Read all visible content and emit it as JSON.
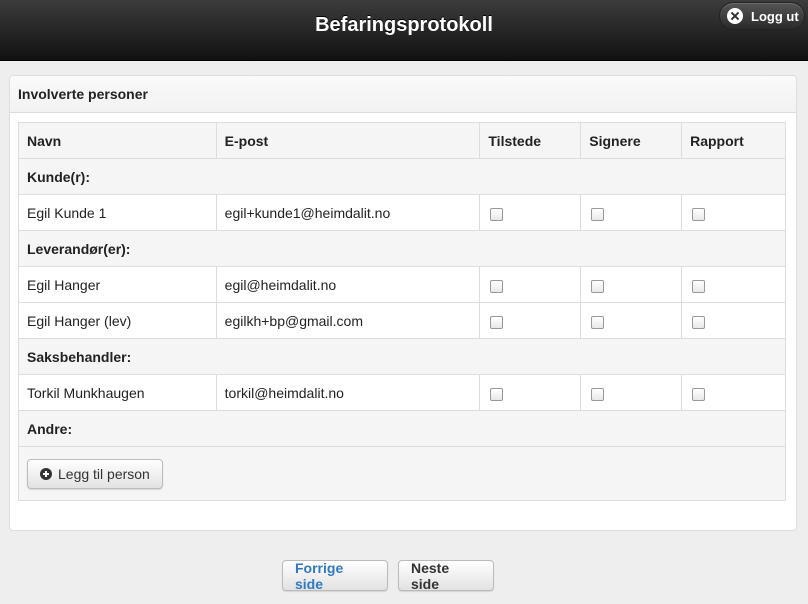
{
  "header": {
    "title": "Befaringsprotokoll",
    "logout_label": "Logg ut"
  },
  "panel": {
    "title": "Involverte personer"
  },
  "table": {
    "columns": [
      "Navn",
      "E-post",
      "Tilstede",
      "Signere",
      "Rapport"
    ],
    "groups": [
      {
        "label": "Kunde(r):",
        "rows": [
          {
            "name": "Egil Kunde 1",
            "email": "egil+kunde1@heimdalit.no",
            "tilstede": false,
            "signere": false,
            "rapport": false
          }
        ]
      },
      {
        "label": "Leverandør(er):",
        "rows": [
          {
            "name": "Egil Hanger",
            "email": "egil@heimdalit.no",
            "tilstede": false,
            "signere": false,
            "rapport": false
          },
          {
            "name": "Egil Hanger (lev)",
            "email": "egilkh+bp@gmail.com",
            "tilstede": false,
            "signere": false,
            "rapport": false
          }
        ]
      },
      {
        "label": "Saksbehandler:",
        "rows": [
          {
            "name": "Torkil Munkhaugen",
            "email": "torkil@heimdalit.no",
            "tilstede": false,
            "signere": false,
            "rapport": false
          }
        ]
      },
      {
        "label": "Andre:",
        "rows": []
      }
    ],
    "add_person_label": "Legg til person"
  },
  "nav": {
    "prev_label": "Forrige side",
    "next_label": "Neste side"
  },
  "colors": {
    "header_bg": "#1e1e1e",
    "link_blue": "#2f7ac0"
  }
}
